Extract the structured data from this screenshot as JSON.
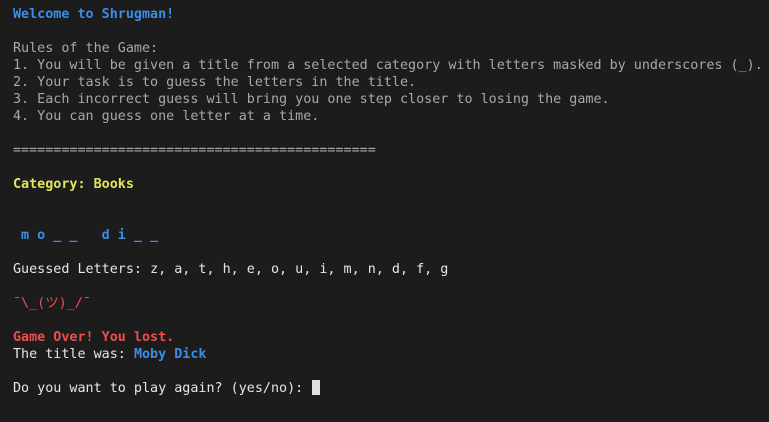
{
  "terminal": {
    "welcome": "Welcome to Shrugman!",
    "rules_title": "Rules of the Game:",
    "rules": [
      "1. You will be given a title from a selected category with letters masked by underscores (_).",
      "2. Your task is to guess the letters in the title.",
      "3. Each incorrect guess will bring you one step closer to losing the game.",
      "4. You can guess one letter at a time."
    ],
    "separator": "=============================================",
    "category": "Category: Books",
    "masked_title": " m o _ _   d i _ _",
    "guessed_label": "Guessed Letters: ",
    "guessed_letters": "z, a, t, h, e, o, u, i, m, n, d, f, g",
    "shrug": "¯\\_(ツ)_/¯",
    "game_over": "Game Over! You lost.",
    "title_was_label": "The title was: ",
    "title_answer": "Moby Dick",
    "prompt": "Do you want to play again? (yes/no): ",
    "input_value": ""
  },
  "colors": {
    "background": "#1c1c1c",
    "text": "#dcdcdc",
    "rules_text": "#a8a8a8",
    "accent_blue": "#3b8eea",
    "accent_yellow": "#e5e55c",
    "accent_red": "#f14c4c"
  }
}
